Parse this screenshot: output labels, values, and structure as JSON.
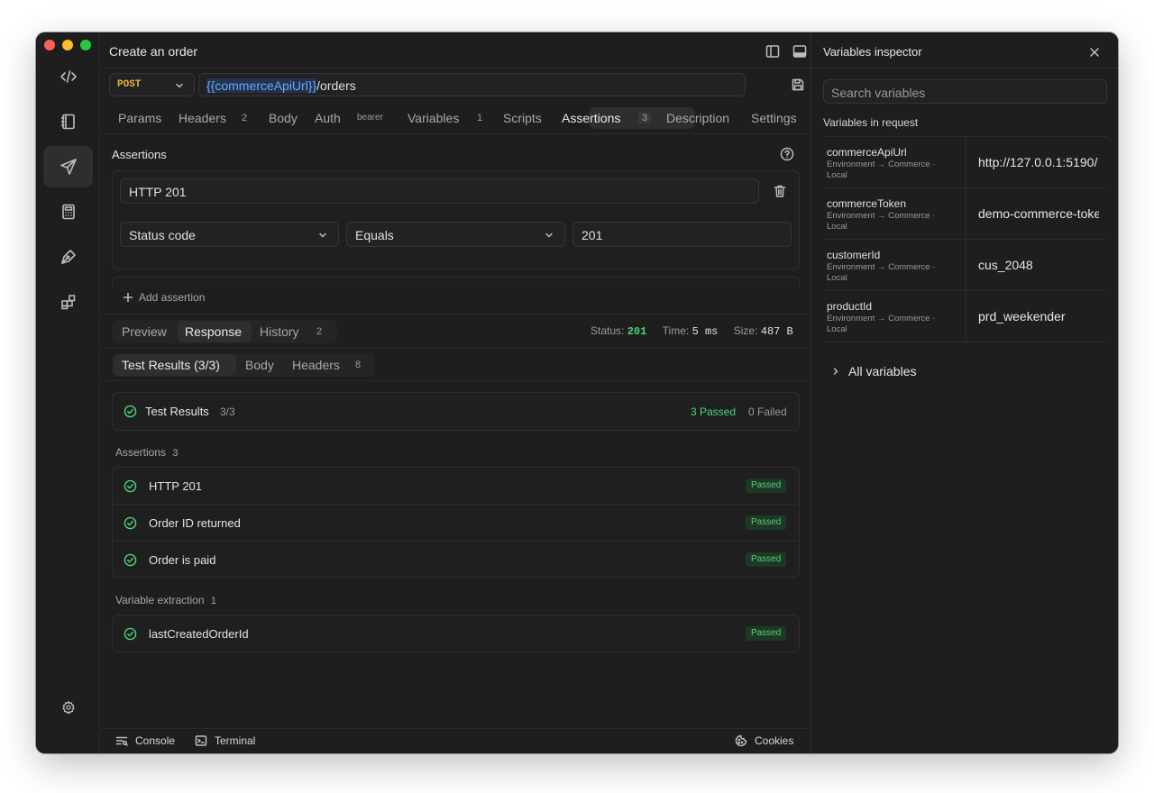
{
  "window": {
    "title": "Create an order"
  },
  "request": {
    "method": "POST",
    "url_variable": "{{commerceApiUrl}}",
    "url_path": "/orders"
  },
  "request_tabs": [
    {
      "label": "Params",
      "count": ""
    },
    {
      "label": "Headers",
      "count": "2"
    },
    {
      "label": "Body",
      "count": ""
    },
    {
      "label": "Auth",
      "count": "bearer"
    },
    {
      "label": "Variables",
      "count": "1"
    },
    {
      "label": "Scripts",
      "count": ""
    },
    {
      "label": "Assertions",
      "count": "3"
    },
    {
      "label": "Description",
      "count": ""
    },
    {
      "label": "Settings",
      "count": ""
    }
  ],
  "assertions_editor": {
    "heading": "Assertions",
    "assertion_name": "HTTP 201",
    "target": "Status code",
    "operator": "Equals",
    "expected": "201",
    "add_label": "Add assertion"
  },
  "response_tabs": [
    {
      "label": "Preview",
      "count": ""
    },
    {
      "label": "Response",
      "count": ""
    },
    {
      "label": "History",
      "count": "2"
    }
  ],
  "response_status": {
    "status_label": "Status:",
    "status_value": "201",
    "time_label": "Time:",
    "time_value": "5 ms",
    "size_label": "Size:",
    "size_value": "487 B"
  },
  "result_tabs": [
    {
      "label": "Test Results (3/3)",
      "count": ""
    },
    {
      "label": "Body",
      "count": ""
    },
    {
      "label": "Headers",
      "count": "8"
    }
  ],
  "test_results": {
    "title": "Test Results",
    "fraction": "3/3",
    "passed": "3 Passed",
    "failed": "0 Failed",
    "assertions_label": "Assertions",
    "assertions_count": "3",
    "assertions": [
      {
        "name": "HTTP 201",
        "status": "Passed"
      },
      {
        "name": "Order ID returned",
        "status": "Passed"
      },
      {
        "name": "Order is paid",
        "status": "Passed"
      }
    ],
    "extraction_label": "Variable extraction",
    "extraction_count": "1",
    "extractions": [
      {
        "name": "lastCreatedOrderId",
        "status": "Passed"
      }
    ]
  },
  "footer": {
    "console": "Console",
    "terminal": "Terminal",
    "cookies": "Cookies"
  },
  "inspector": {
    "title": "Variables inspector",
    "search_placeholder": "Search variables",
    "section_label": "Variables in request",
    "variables": [
      {
        "name": "commerceApiUrl",
        "source": "Environment → Commerce · Local",
        "value": "http://127.0.0.1:5190/"
      },
      {
        "name": "commerceToken",
        "source": "Environment → Commerce · Local",
        "value": "demo-commerce-token"
      },
      {
        "name": "customerId",
        "source": "Environment → Commerce · Local",
        "value": "cus_2048"
      },
      {
        "name": "productId",
        "source": "Environment → Commerce · Local",
        "value": "prd_weekender"
      }
    ],
    "all_variables": "All variables"
  },
  "colors": {
    "background": "#1e1e1e",
    "accent_green": "#4fd37b",
    "method_yellow": "#e8b832",
    "variable_blue": "#6aa7ff",
    "traffic_red": "#ff5f57",
    "traffic_yellow": "#febc2e",
    "traffic_green": "#28c840"
  }
}
